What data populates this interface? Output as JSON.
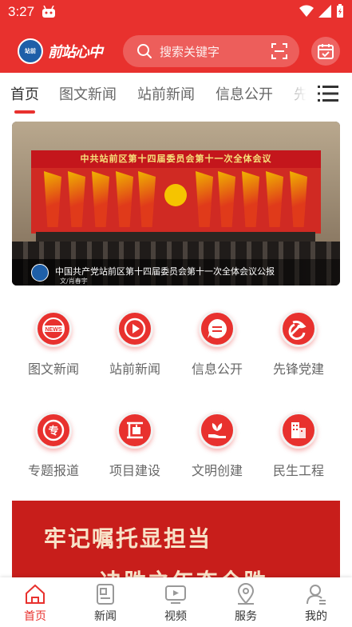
{
  "status_bar": {
    "time": "3:27"
  },
  "header": {
    "logo_badge": "站前",
    "logo_text": "前站心中",
    "search_placeholder": "搜索关键字"
  },
  "tabs": [
    {
      "label": "首页",
      "active": true
    },
    {
      "label": "图文新闻"
    },
    {
      "label": "站前新闻"
    },
    {
      "label": "信息公开"
    },
    {
      "label": "先"
    }
  ],
  "banner": {
    "meeting_banner": "中共站前区第十四届委员会第十一次全体会议",
    "caption": "中国共产党站前区第十四届委员会第十一次全体会议公报",
    "sub_caption": "文/肖春宇"
  },
  "grid": [
    {
      "label": "图文新闻",
      "icon": "news-icon"
    },
    {
      "label": "站前新闻",
      "icon": "play-icon"
    },
    {
      "label": "信息公开",
      "icon": "chat-icon"
    },
    {
      "label": "先锋党建",
      "icon": "party-emblem-icon"
    },
    {
      "label": "专题报道",
      "icon": "topic-icon"
    },
    {
      "label": "项目建设",
      "icon": "construction-icon"
    },
    {
      "label": "文明创建",
      "icon": "hand-plant-icon"
    },
    {
      "label": "民生工程",
      "icon": "building-icon"
    }
  ],
  "promo": {
    "line1": "牢记嘱托显担当",
    "line2": "决胜之年奋全胜"
  },
  "bottom_nav": [
    {
      "label": "首页",
      "icon": "home-icon",
      "active": true
    },
    {
      "label": "新闻",
      "icon": "newspaper-icon"
    },
    {
      "label": "视频",
      "icon": "tv-icon"
    },
    {
      "label": "服务",
      "icon": "location-icon"
    },
    {
      "label": "我的",
      "icon": "profile-icon"
    }
  ],
  "colors": {
    "primary": "#e8312e",
    "active_tab_text": "#333333",
    "inactive_text": "#666666"
  }
}
